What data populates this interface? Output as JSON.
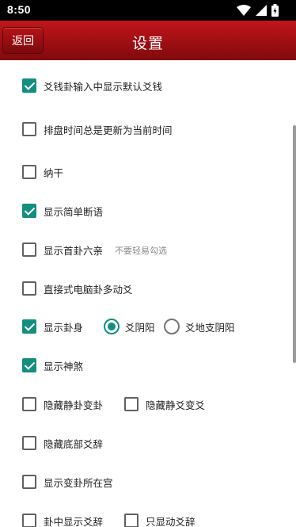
{
  "status_bar": {
    "time": "8:50",
    "icons": [
      "wifi-icon",
      "signal-icon",
      "battery-icon"
    ]
  },
  "app_bar": {
    "back_label": "返回",
    "title": "设置"
  },
  "colors": {
    "accent": "#138f80",
    "app_bar": "#9e0e12"
  },
  "settings": {
    "r1": {
      "label": "爻钱卦输入中显示默认爻钱",
      "checked": true
    },
    "r2": {
      "label": "排盘时间总是更新为当前时间",
      "checked": false
    },
    "r3": {
      "label": "纳干",
      "checked": false
    },
    "r4": {
      "label": "显示简单断语",
      "checked": true
    },
    "r5": {
      "label": "显示首卦六亲",
      "checked": false,
      "hint": "不要轻易勾选"
    },
    "r6": {
      "label": "直接式电脑卦多动爻",
      "checked": false
    },
    "r7": {
      "label": "显示卦身",
      "checked": true,
      "radio_a": {
        "label": "爻阴阳",
        "selected": true
      },
      "radio_b": {
        "label": "爻地支阴阳",
        "selected": false
      }
    },
    "r8": {
      "label": "显示神煞",
      "checked": true
    },
    "r9": {
      "a": {
        "label": "隐藏静卦变卦",
        "checked": false
      },
      "b": {
        "label": "隐藏静爻变爻",
        "checked": false
      }
    },
    "r10": {
      "label": "隐藏底部爻辞",
      "checked": false
    },
    "r11": {
      "label": "显示变卦所在宫",
      "checked": false
    },
    "r12": {
      "a": {
        "label": "卦中显示爻辞",
        "checked": false
      },
      "b": {
        "label": "只显动爻辞",
        "checked": false
      }
    }
  }
}
